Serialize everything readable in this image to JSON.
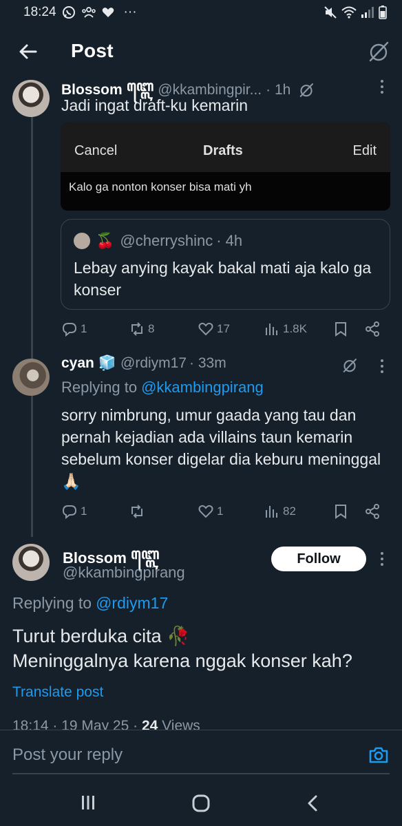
{
  "status_bar": {
    "time": "18:24",
    "more": "···"
  },
  "header": {
    "title": "Post"
  },
  "tweet1": {
    "name": "Blossom",
    "script_name": "ꦧ꧀ꦭꦺ",
    "handle": "@kkambingpir...",
    "time": "· 1h",
    "text": "Jadi ingat draft-ku kemarin",
    "drafts_image": {
      "cancel": "Cancel",
      "title": "Drafts",
      "edit": "Edit",
      "draft_text": "Kalo ga nonton konser bisa mati yh"
    },
    "quote": {
      "emoji": "🍒",
      "handle": "@cherryshinc",
      "time": "· 4h",
      "text": "Lebay anying kayak bakal mati aja kalo ga konser"
    },
    "replies": "1",
    "reposts": "8",
    "likes": "17",
    "views": "1.8K"
  },
  "tweet2": {
    "name": "cyan",
    "emoji": "🧊",
    "handle": "@rdiym17",
    "time": "· 33m",
    "replying_prefix": "Replying to",
    "replying_to": "@kkambingpirang",
    "text": "sorry nimbrung, umur gaada yang tau dan pernah kejadian ada villains taun kemarin sebelum konser digelar dia keburu meninggal 🙏🏻",
    "replies": "1",
    "reposts": "",
    "likes": "1",
    "views": "82"
  },
  "main_tweet": {
    "name": "Blossom",
    "script_name": "ꦧ꧀ꦭꦺ",
    "handle": "@kkambingpirang",
    "follow_label": "Follow",
    "replying_prefix": "Replying to",
    "replying_to": "@rdiym17",
    "line1": "Turut berduka cita 🥀",
    "line2": "Meninggalnya karena nggak konser kah?",
    "translate": "Translate post",
    "meta_time": "18:14 · 19 May 25 ·",
    "meta_views_count": "24",
    "meta_views_label": "Views"
  },
  "reply_bar": {
    "placeholder": "Post your reply"
  },
  "colors": {
    "background": "#15202b",
    "accent": "#1d9bf0",
    "muted": "#8b98a5",
    "border": "#38444d"
  },
  "icons": [
    "whatsapp-icon",
    "group-icon",
    "heart-icon",
    "mute-icon",
    "wifi-icon",
    "signal-icon",
    "battery-icon",
    "back-arrow-icon",
    "grok-icon",
    "more-icon",
    "reply-icon",
    "repost-icon",
    "like-icon",
    "views-icon",
    "bookmark-icon",
    "share-icon",
    "camera-icon"
  ]
}
